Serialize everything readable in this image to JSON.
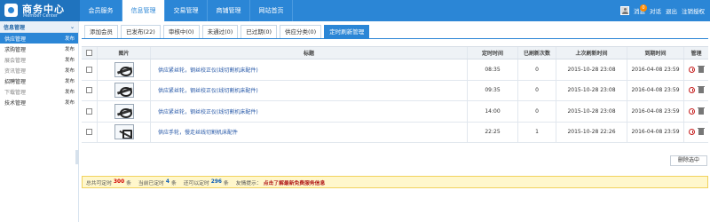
{
  "header": {
    "logo_title": "商务中心",
    "logo_subtitle": "Member Center",
    "nav": [
      {
        "label": "会员服务",
        "active": false
      },
      {
        "label": "信息管理",
        "active": true
      },
      {
        "label": "交易管理",
        "active": false
      },
      {
        "label": "商铺管理",
        "active": false
      },
      {
        "label": "网站首页",
        "active": false
      }
    ],
    "user": {
      "badge": "0",
      "message": "消息",
      "chat": "对话",
      "logout": "退出",
      "upgrade": "注销授权"
    }
  },
  "sidebar": {
    "title": "信息管理",
    "items": [
      {
        "label": "供应管理",
        "action": "发布",
        "active": true
      },
      {
        "label": "求购管理",
        "action": "发布",
        "active": false
      },
      {
        "label": "展会管理",
        "action": "发布",
        "active": false
      },
      {
        "label": "资讯管理",
        "action": "发布",
        "active": false
      },
      {
        "label": "招聘管理",
        "action": "发布",
        "active": false
      },
      {
        "label": "下载管理",
        "action": "发布",
        "active": false
      },
      {
        "label": "技术管理",
        "action": "发布",
        "active": false
      }
    ]
  },
  "tabs": [
    {
      "label": "添加会员",
      "active": false
    },
    {
      "label": "已发布(22)",
      "active": false
    },
    {
      "label": "审核中(0)",
      "active": false
    },
    {
      "label": "未通过(0)",
      "active": false
    },
    {
      "label": "已过期(0)",
      "active": false
    },
    {
      "label": "供应分类(0)",
      "active": false
    },
    {
      "label": "定时刷新管理",
      "active": true
    }
  ],
  "table": {
    "headers": {
      "image": "图片",
      "title": "标题",
      "time": "定时时间",
      "refresh_count": "已刷新次数",
      "last_refresh": "上次刷新时间",
      "expiry": "到期时间",
      "manage": "管理"
    },
    "rows": [
      {
        "title": "供应紧丝轮，钢丝校正仪(线切割机床配件)",
        "time": "08:35",
        "count": "0",
        "last": "2015-10-28 23:08",
        "expiry": "2016-04-08 23:59",
        "image": "pulley-icon"
      },
      {
        "title": "供应紧丝轮，钢丝校正仪(线切割机床配件)",
        "time": "09:35",
        "count": "0",
        "last": "2015-10-28 23:08",
        "expiry": "2016-04-08 23:59",
        "image": "pulley-icon"
      },
      {
        "title": "供应紧丝轮，钢丝校正仪(线切割机床配件)",
        "time": "14:00",
        "count": "0",
        "last": "2015-10-28 23:08",
        "expiry": "2016-04-08 23:59",
        "image": "pulley-icon"
      },
      {
        "title": "供应手轮，慢走丝线切割机床配件",
        "time": "22:25",
        "count": "1",
        "last": "2015-10-28 22:26",
        "expiry": "2016-04-08 23:59",
        "image": "handwheel-icon"
      }
    ]
  },
  "actions": {
    "delete_selected": "删除选中"
  },
  "footer": {
    "total_prefix": "总共可定时",
    "total_value": "300",
    "total_suffix": "条",
    "current_prefix": "当前已定时",
    "current_value": "4",
    "current_suffix": "条",
    "remaining_prefix": "还可以定时",
    "remaining_value": "296",
    "remaining_suffix": "条",
    "hint_label": "友情提示：",
    "hint_text": "点击了解最新免费服务信息"
  },
  "colors": {
    "primary": "#2b86d6",
    "warning_bg": "#fff7cc",
    "danger": "#d10000"
  }
}
